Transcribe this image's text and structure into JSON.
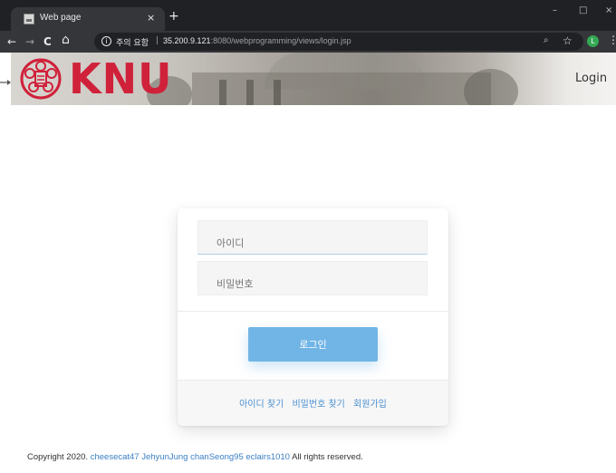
{
  "browser": {
    "tab_title": "Web page",
    "tab_close": "×",
    "new_tab": "+",
    "win_min": "–",
    "win_max": "□",
    "win_close": "×",
    "nav_back": "←",
    "nav_forward": "→",
    "nav_reload": "C",
    "nav_home": "⌂",
    "info": "i",
    "security_label": "주의 요함",
    "separator": "|",
    "url_host": "35.200.9.121",
    "url_rest": ":8080/webprogramming/views/login.jsp",
    "zoom": "⌕",
    "star": "☆",
    "profile": "L",
    "menu": "⋮"
  },
  "header": {
    "logo_text": "KNU",
    "nav_login": "Login"
  },
  "login_form": {
    "id_placeholder": "아이디",
    "password_placeholder": "비밀번호",
    "submit_label": "로그인",
    "links": {
      "find_id": "아이디 찾기",
      "find_password": "비밀번호 찾기",
      "signup": "회원가입"
    }
  },
  "footer": {
    "prefix": "Copyright 2020.",
    "authors": "cheesecat47 JehyunJung chanSeong95 eclairs1010",
    "suffix": "All rights reserved."
  },
  "colors": {
    "brand_red": "#d0213a",
    "button_blue": "#71b5e6",
    "link_blue": "#4a8fd0"
  }
}
